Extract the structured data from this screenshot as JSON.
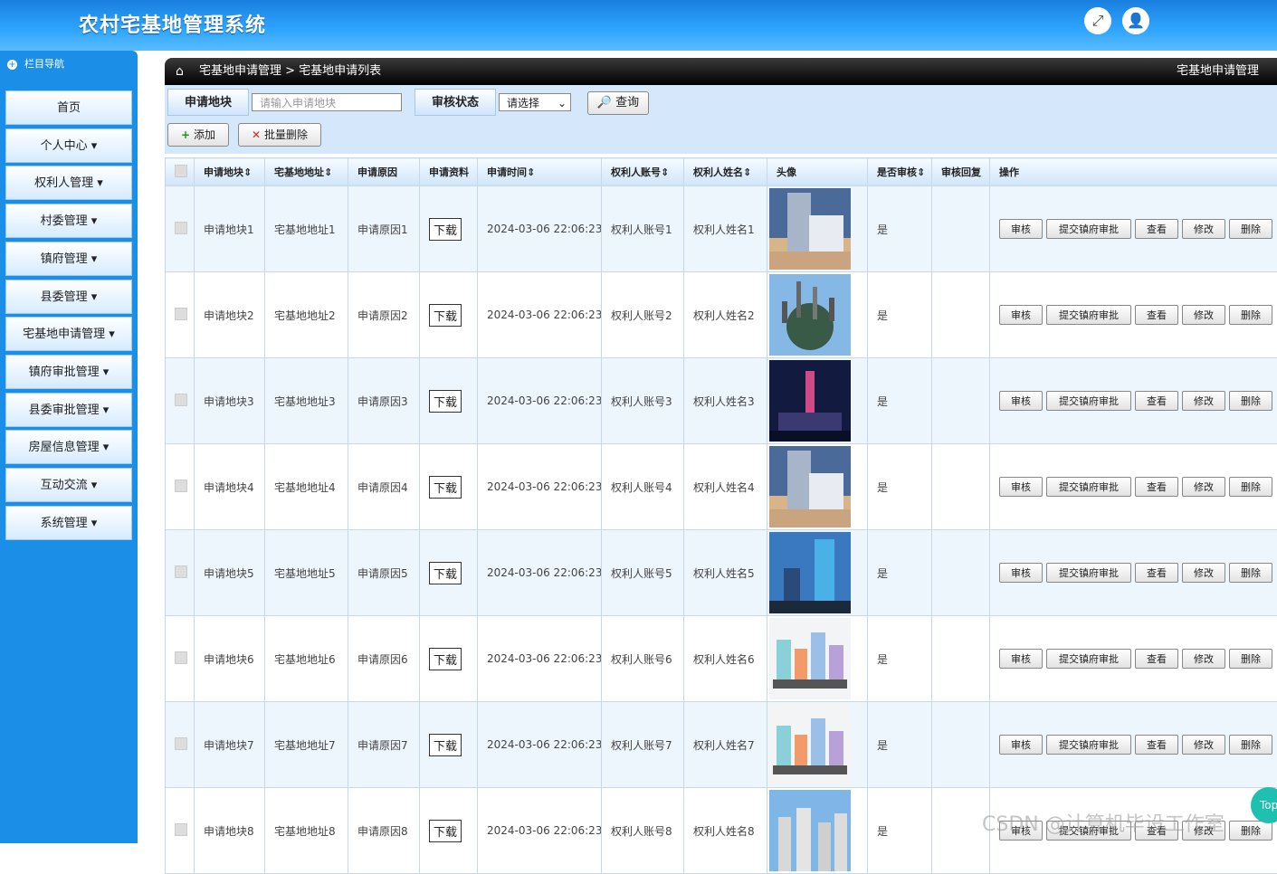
{
  "app": {
    "title": "农村宅基地管理系统"
  },
  "header_icons": [
    "fullscreen-icon",
    "user-icon"
  ],
  "sidebar": {
    "heading": "栏目导航",
    "items": [
      {
        "label": "首页"
      },
      {
        "label": "个人中心 ▾"
      },
      {
        "label": "权利人管理 ▾"
      },
      {
        "label": "村委管理 ▾"
      },
      {
        "label": "镇府管理 ▾"
      },
      {
        "label": "县委管理 ▾"
      },
      {
        "label": "宅基地申请管理 ▾"
      },
      {
        "label": "镇府审批管理 ▾"
      },
      {
        "label": "县委审批管理 ▾"
      },
      {
        "label": "房屋信息管理 ▾"
      },
      {
        "label": "互动交流 ▾"
      },
      {
        "label": "系统管理 ▾"
      }
    ]
  },
  "breadcrumb": {
    "path": "宅基地申请管理 > 宅基地申请列表",
    "current": "宅基地申请管理"
  },
  "search": {
    "field_label": "申请地块",
    "field_placeholder": "请输入申请地块",
    "status_label": "审核状态",
    "status_selected": "请选择",
    "query_label": "查询",
    "add_label": "添加",
    "batch_delete_label": "批量删除"
  },
  "table": {
    "headers": [
      "",
      "申请地块⇕",
      "宅基地地址⇕",
      "申请原因",
      "申请资料",
      "申请时间⇕",
      "权利人账号⇕",
      "权利人姓名⇕",
      "头像",
      "是否审核⇕",
      "审核回复",
      "操作"
    ],
    "download_label": "下载",
    "actions": [
      "审核",
      "提交镇府审批",
      "查看",
      "修改",
      "删除"
    ],
    "rows": [
      {
        "plot": "申请地块1",
        "address": "宅基地地址1",
        "reason": "申请原因1",
        "time": "2024-03-06 22:06:23",
        "account": "权利人账号1",
        "name": "权利人姓名1",
        "reviewed": "是",
        "reply": "",
        "img": "tower"
      },
      {
        "plot": "申请地块2",
        "address": "宅基地地址2",
        "reason": "申请原因2",
        "time": "2024-03-06 22:06:23",
        "account": "权利人账号2",
        "name": "权利人姓名2",
        "reviewed": "是",
        "reply": "",
        "img": "planet"
      },
      {
        "plot": "申请地块3",
        "address": "宅基地地址3",
        "reason": "申请原因3",
        "time": "2024-03-06 22:06:23",
        "account": "权利人账号3",
        "name": "权利人姓名3",
        "reviewed": "是",
        "reply": "",
        "img": "night"
      },
      {
        "plot": "申请地块4",
        "address": "宅基地地址4",
        "reason": "申请原因4",
        "time": "2024-03-06 22:06:23",
        "account": "权利人账号4",
        "name": "权利人姓名4",
        "reviewed": "是",
        "reply": "",
        "img": "tower"
      },
      {
        "plot": "申请地块5",
        "address": "宅基地地址5",
        "reason": "申请原因5",
        "time": "2024-03-06 22:06:23",
        "account": "权利人账号5",
        "name": "权利人姓名5",
        "reviewed": "是",
        "reply": "",
        "img": "blue"
      },
      {
        "plot": "申请地块6",
        "address": "宅基地地址6",
        "reason": "申请原因6",
        "time": "2024-03-06 22:06:23",
        "account": "权利人账号6",
        "name": "权利人姓名6",
        "reviewed": "是",
        "reply": "",
        "img": "cartoon"
      },
      {
        "plot": "申请地块7",
        "address": "宅基地地址7",
        "reason": "申请原因7",
        "time": "2024-03-06 22:06:23",
        "account": "权利人账号7",
        "name": "权利人姓名7",
        "reviewed": "是",
        "reply": "",
        "img": "cartoon"
      },
      {
        "plot": "申请地块8",
        "address": "宅基地地址8",
        "reason": "申请原因8",
        "time": "2024-03-06 22:06:23",
        "account": "权利人账号8",
        "name": "权利人姓名8",
        "reviewed": "是",
        "reply": "",
        "img": "highrise"
      }
    ]
  },
  "watermark": "CSDN @计算机毕设工作室",
  "top_button": "Top"
}
